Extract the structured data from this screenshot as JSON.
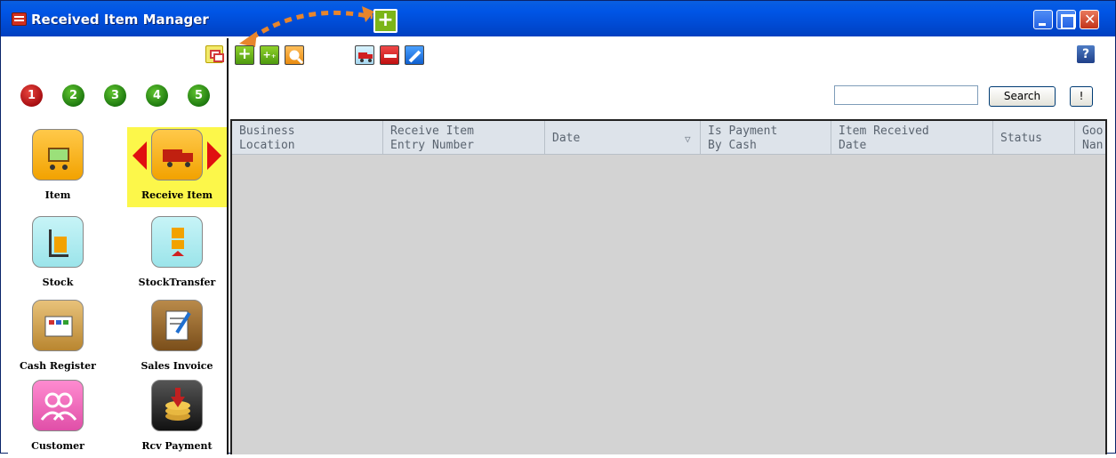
{
  "window": {
    "title": "Received Item Manager"
  },
  "sidebar": {
    "steps": [
      "1",
      "2",
      "3",
      "4",
      "5"
    ],
    "active_step": "1",
    "tiles": [
      {
        "label": "Item",
        "icon": "shopping-cart-icon"
      },
      {
        "label": "Receive Item",
        "icon": "delivery-truck-icon"
      },
      {
        "label": "Stock",
        "icon": "hand-truck-icon"
      },
      {
        "label": "StockTransfer",
        "icon": "stock-transfer-icon"
      },
      {
        "label": "Cash Register",
        "icon": "cash-register-icon"
      },
      {
        "label": "Sales Invoice",
        "icon": "invoice-icon"
      },
      {
        "label": "Customer",
        "icon": "customers-icon"
      },
      {
        "label": "Rcv Payment",
        "icon": "receive-payment-icon"
      }
    ],
    "selected_tile": "Receive Item"
  },
  "toolbar": {
    "buttons": [
      {
        "name": "add",
        "icon": "plus-icon"
      },
      {
        "name": "add-multiple",
        "icon": "plus-plus-icon"
      },
      {
        "name": "search",
        "icon": "magnifier-icon"
      },
      {
        "name": "receive",
        "icon": "truck-icon"
      },
      {
        "name": "delete",
        "icon": "minus-icon"
      },
      {
        "name": "edit",
        "icon": "pencil-icon"
      }
    ],
    "help_label": "?"
  },
  "search": {
    "value": "",
    "button_label": "Search",
    "extra_label": "!"
  },
  "grid": {
    "columns": [
      {
        "line1": "Business",
        "line2": "Location"
      },
      {
        "line1": "Receive Item",
        "line2": "Entry Number"
      },
      {
        "line1": "Date",
        "line2": ""
      },
      {
        "line1": "Is Payment",
        "line2": "By Cash"
      },
      {
        "line1": "Item Received",
        "line2": "Date"
      },
      {
        "line1": "Status",
        "line2": ""
      },
      {
        "line1": "Goo",
        "line2": "Nan"
      }
    ],
    "rows": []
  },
  "colors": {
    "titlebar": "#0055e6",
    "grid_background": "#d3d3d3",
    "selected_tile": "#fcf74a",
    "callout": "#e55b3c",
    "callout_dash": "#e8852c"
  }
}
